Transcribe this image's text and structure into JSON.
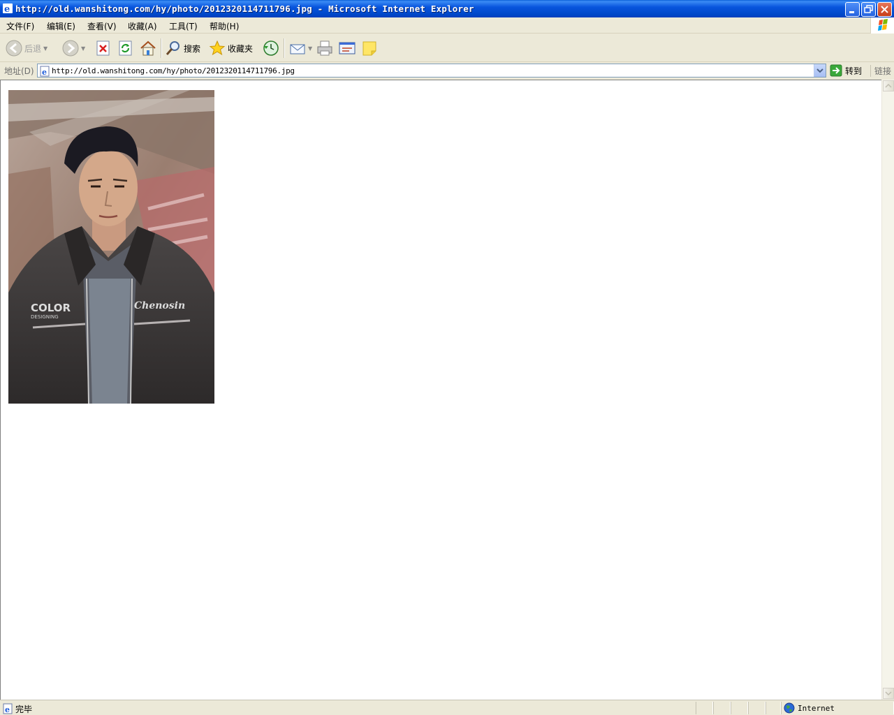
{
  "window": {
    "title": "http://old.wanshitong.com/hy/photo/2012320114711796.jpg - Microsoft Internet Explorer"
  },
  "menu": {
    "items": [
      {
        "label": "文件(F)"
      },
      {
        "label": "编辑(E)"
      },
      {
        "label": "查看(V)"
      },
      {
        "label": "收藏(A)"
      },
      {
        "label": "工具(T)"
      },
      {
        "label": "帮助(H)"
      }
    ]
  },
  "toolbar": {
    "back_label": "后退",
    "search_label": "搜索",
    "favorites_label": "收藏夹"
  },
  "address": {
    "label": "地址(D)",
    "url": "http://old.wanshitong.com/hy/photo/2012320114711796.jpg",
    "go_label": "转到",
    "links_label": "链接"
  },
  "content": {
    "photo_shirt_text_left": "COLOR",
    "photo_shirt_text_left_sub": "DESIGNING",
    "photo_shirt_text_right": "Chenosin"
  },
  "status": {
    "text": "完毕",
    "zone": "Internet"
  }
}
